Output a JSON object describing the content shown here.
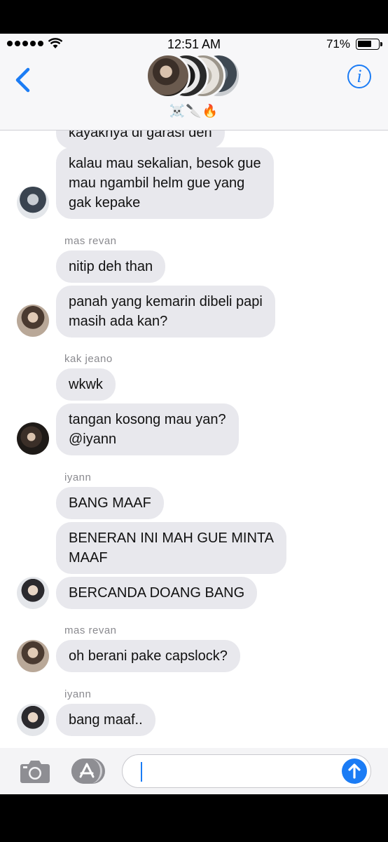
{
  "status_bar": {
    "time": "12:51 AM",
    "battery_percent": "71%",
    "battery_level": 0.71,
    "signal_bars": 5
  },
  "header": {
    "group_name": "☠️🔪🔥",
    "back_icon": "chevron-left-icon",
    "info_icon": "info-icon",
    "info_glyph": "i"
  },
  "messages": [
    {
      "text": "kayaknya di garasi deh",
      "avatar": false
    },
    {
      "text": "kalau mau sekalian, besok gue\nmau ngambil helm gue yang\ngak kepake",
      "avatar": true
    },
    {
      "sender": "mas revan"
    },
    {
      "text": "nitip deh than",
      "avatar": false
    },
    {
      "text": "panah yang kemarin dibeli papi\nmasih ada kan?",
      "avatar": true
    },
    {
      "sender": "kak jeano"
    },
    {
      "text": "wkwk",
      "avatar": false
    },
    {
      "text": "tangan kosong mau yan?\n@iyann",
      "avatar": true
    },
    {
      "sender": "iyann"
    },
    {
      "text": "BANG MAAF",
      "avatar": false
    },
    {
      "text": "BENERAN INI MAH GUE MINTA\nMAAF",
      "avatar": false
    },
    {
      "text": "BERCANDA DOANG BANG",
      "avatar": true
    },
    {
      "sender": "mas revan"
    },
    {
      "text": "oh berani pake capslock?",
      "avatar": true
    },
    {
      "sender": "iyann"
    },
    {
      "text": "bang maaf..",
      "avatar": true
    }
  ],
  "input_bar": {
    "camera_icon": "camera-icon",
    "apps_icon": "app-store-icon",
    "send_icon": "arrow-up-icon",
    "message_value": ""
  },
  "colors": {
    "accent": "#1b7cf5",
    "bubble": "#e8e8ed",
    "header_bg": "#f7f7f9"
  }
}
